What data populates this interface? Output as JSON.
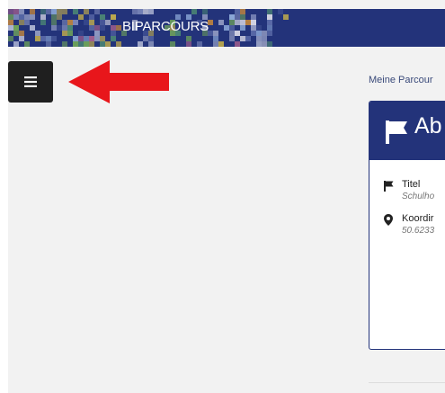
{
  "header": {
    "logo_text": "BIPARCOURS",
    "brand_color": "#23337a"
  },
  "menu_button": {
    "icon": "hamburger-icon"
  },
  "annotation": {
    "icon": "red-arrow-left",
    "color": "#e8161b"
  },
  "breadcrumb": {
    "text": "Meine Parcour"
  },
  "card": {
    "title": "Ab",
    "title_icon": "flag-icon",
    "fields": [
      {
        "icon": "flag-icon",
        "label": "Titel",
        "value": "Schulho"
      },
      {
        "icon": "map-marker-icon",
        "label": "Koordir",
        "value": "50.6233"
      }
    ]
  }
}
